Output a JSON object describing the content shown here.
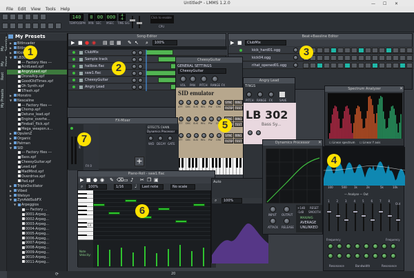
{
  "window": {
    "title": "Untitled* - LMMS 1.2.0"
  },
  "menu": [
    "File",
    "Edit",
    "View",
    "Tools",
    "Help"
  ],
  "toolbar": {
    "tempo": "140",
    "tempo_label": "TEMPO/BPM",
    "time_min": "0",
    "time_sec": "00",
    "time_msec": "000",
    "time_labels": [
      "MIN",
      "SEC",
      "MSEC"
    ],
    "timesig_top": "4",
    "timesig_bottom": "4",
    "timesig_label": "TIME SIG",
    "cpu_hint": "Click to enable",
    "cpu_label": "CPU"
  },
  "side_tabs": [
    "My Presets",
    "My Samples",
    "My Home",
    "Root"
  ],
  "presets": {
    "title": "My Presets",
    "rows": [
      {
        "label": "BitInvader",
        "indent": 2,
        "type": "folder",
        "open": false
      },
      {
        "label": "BitInvader",
        "indent": 2,
        "type": "folder",
        "open": false
      },
      {
        "label": "Kicker",
        "indent": 2,
        "type": "folder",
        "open": false
      },
      {
        "label": "LB302",
        "indent": 2,
        "type": "folder",
        "open": true
      },
      {
        "label": "--- Factory files ---",
        "indent": 4,
        "type": "file"
      },
      {
        "label": "AcidLead.xpf",
        "indent": 4,
        "type": "file"
      },
      {
        "label": "AngryLead.xpf",
        "indent": 4,
        "type": "file",
        "selected": true
      },
      {
        "label": "DroneArp.xpf",
        "indent": 4,
        "type": "file"
      },
      {
        "label": "GoodOldTimes.xpf",
        "indent": 4,
        "type": "file"
      },
      {
        "label": "Oh Synth.xpf",
        "indent": 4,
        "type": "file"
      },
      {
        "label": "STrash.xpf",
        "indent": 4,
        "type": "file"
      },
      {
        "label": "Monstro",
        "indent": 2,
        "type": "folder",
        "open": false
      },
      {
        "label": "Nescaline",
        "indent": 2,
        "type": "folder",
        "open": true
      },
      {
        "label": "--- Factory files ---",
        "indent": 4,
        "type": "file"
      },
      {
        "label": "Chomp.xpf",
        "indent": 4,
        "type": "file"
      },
      {
        "label": "Detune_lead.xpf",
        "indent": 4,
        "type": "file"
      },
      {
        "label": "Engine_overhe...",
        "indent": 4,
        "type": "file"
      },
      {
        "label": "Fireball_flick.xpf",
        "indent": 4,
        "type": "file"
      },
      {
        "label": "Mega_weapon.x...",
        "indent": 4,
        "type": "file"
      },
      {
        "label": "OpulenZ",
        "indent": 2,
        "type": "folder",
        "open": false
      },
      {
        "label": "Organic",
        "indent": 2,
        "type": "folder",
        "open": false
      },
      {
        "label": "Patman",
        "indent": 2,
        "type": "folder",
        "open": false
      },
      {
        "label": "SID",
        "indent": 2,
        "type": "folder",
        "open": true
      },
      {
        "label": "--- Factory files ---",
        "indent": 4,
        "type": "file"
      },
      {
        "label": "Bass.xpf",
        "indent": 4,
        "type": "file"
      },
      {
        "label": "CheesyGuitar.xpf",
        "indent": 4,
        "type": "file"
      },
      {
        "label": "Lead.xpf",
        "indent": 4,
        "type": "file"
      },
      {
        "label": "MadMind.xpf",
        "indent": 4,
        "type": "file"
      },
      {
        "label": "Overdrive.xpf",
        "indent": 4,
        "type": "file"
      },
      {
        "label": "Pad.xpf",
        "indent": 4,
        "type": "file"
      },
      {
        "label": "TripleOscillator",
        "indent": 2,
        "type": "folder",
        "open": false
      },
      {
        "label": "Vibed",
        "indent": 2,
        "type": "folder",
        "open": false
      },
      {
        "label": "Watsyn",
        "indent": 2,
        "type": "folder",
        "open": false
      },
      {
        "label": "ZynAddSubFX",
        "indent": 2,
        "type": "folder",
        "open": true
      },
      {
        "label": "Arpeggios",
        "indent": 4,
        "type": "folder",
        "open": true
      },
      {
        "label": "--- Factory ...",
        "indent": 6,
        "type": "file"
      },
      {
        "label": "0001-Arpeg...",
        "indent": 6,
        "type": "file"
      },
      {
        "label": "0002-Arpeg...",
        "indent": 6,
        "type": "file"
      },
      {
        "label": "0003-Arpeg...",
        "indent": 6,
        "type": "file"
      },
      {
        "label": "0004-Arpeg...",
        "indent": 6,
        "type": "file"
      },
      {
        "label": "0005-Arpeg...",
        "indent": 6,
        "type": "file"
      },
      {
        "label": "0006-Arpeg...",
        "indent": 6,
        "type": "file"
      },
      {
        "label": "0007-Arpeg...",
        "indent": 6,
        "type": "file"
      },
      {
        "label": "0008-Arpeg...",
        "indent": 6,
        "type": "file"
      },
      {
        "label": "0009-Arpeg...",
        "indent": 6,
        "type": "file"
      },
      {
        "label": "0010-Arpeg...",
        "indent": 6,
        "type": "file"
      },
      {
        "label": "0011-Arpeg...",
        "indent": 6,
        "type": "file"
      }
    ]
  },
  "song_editor": {
    "title": "Song-Editor",
    "zoom": "100%",
    "tracks": [
      {
        "name": "ClubMix"
      },
      {
        "name": "Sample track"
      },
      {
        "name": "hallbse.flac"
      },
      {
        "name": "saw1.flac"
      },
      {
        "name": "CheesyGuitar"
      },
      {
        "name": "Angry Lead"
      }
    ]
  },
  "bb_editor": {
    "title": "Beat+Bassline Editor",
    "selected": "ClubMix",
    "tracks": [
      {
        "name": "kick_hard01.ogg"
      },
      {
        "name": "kick04.ogg"
      },
      {
        "name": "rihat_opened01.ogg"
      }
    ],
    "patterns": [
      [
        1,
        0,
        0,
        0,
        1,
        0,
        0,
        0,
        1,
        0,
        0,
        0,
        1,
        0,
        0,
        0
      ],
      [
        0,
        0,
        0,
        0,
        0,
        0,
        0,
        0,
        0,
        0,
        0,
        0,
        0,
        0,
        0,
        0
      ],
      [
        0,
        0,
        1,
        0,
        0,
        0,
        1,
        0,
        0,
        0,
        1,
        0,
        0,
        0,
        1,
        0
      ]
    ]
  },
  "instrument_cheesy": {
    "title": "CheesyGuitar",
    "general_settings": "GENERAL SETTINGS",
    "name_field": "CheesyGuitar",
    "knob_labels": [
      "VOL",
      "PAN",
      "PITCH",
      "RANGE",
      "FX"
    ],
    "plugin_title": "SID emulator",
    "sid_buttons": [
      "ATT",
      "DEC",
      "SUS",
      "REL",
      "PW",
      "CRS",
      "SYNC",
      "RING",
      "FILTERED",
      "TEST"
    ],
    "sid_right": [
      "ATT",
      "DEC",
      "SUS",
      "REL",
      "PW",
      "CRS"
    ]
  },
  "instrument_angry": {
    "title": "Angry Lead",
    "tab": "TINGS",
    "knob_labels": [
      "PITCH",
      "RANGE",
      "FX",
      "SAVE"
    ],
    "plugin_title": "LB 302",
    "plugin_sub": "Bass Sy..."
  },
  "fx_mixer": {
    "title": "FX-Mixer",
    "chain_title": "EFFECTS CHAIN",
    "effect_name": "Dynamics Processor",
    "knob_labels": [
      "W/D",
      "DECAY",
      "GATE"
    ],
    "channel_label": "FX 0",
    "master_label": "Master",
    "add_button": "+"
  },
  "piano_roll": {
    "title": "Piano-Roll - saw1.flac",
    "zoom": "100%",
    "quant": "1/16",
    "note_len": "Last note",
    "scale": "No scale",
    "note_velocity_label": "Note Velocity:",
    "key_label": "C4",
    "notes": [
      {
        "row": 3,
        "start": 0.0,
        "len": 0.1
      },
      {
        "row": 5,
        "start": 0.13,
        "len": 0.1
      },
      {
        "row": 2,
        "start": 0.27,
        "len": 0.1
      },
      {
        "row": 6,
        "start": 0.4,
        "len": 0.1
      },
      {
        "row": 4,
        "start": 0.55,
        "len": 0.1
      },
      {
        "row": 7,
        "start": 0.7,
        "len": 0.1
      },
      {
        "row": 3,
        "start": 0.85,
        "len": 0.1
      }
    ],
    "velocities": [
      0.9,
      0.7,
      0.8,
      0.6,
      0.85,
      0.55,
      0.75,
      0.9,
      0.65,
      0.8
    ]
  },
  "automation": {
    "label": "Auto",
    "zoom": "100%",
    "bottom_value": "20"
  },
  "dynamics": {
    "title": "Dynamics Processor",
    "knob_labels": [
      "INPUT",
      "OUTPUT",
      "ATTACK",
      "RELEASE"
    ],
    "right_buttons": [
      "+1dB",
      "RESET",
      "-1dB",
      "SMOOTH"
    ],
    "mode_labels": [
      "MAX/AVG",
      "AVERAGE",
      "UNLINKED"
    ]
  },
  "spectrum": {
    "title": "Spectrum Analyzer",
    "option_linear_spectrum": "Linear spectrum",
    "option_linear_y": "Linear Y axis",
    "freq_labels": [
      "100",
      "500",
      "1k",
      "2k",
      "5k",
      "10k"
    ],
    "legend_analyse": "Analyse",
    "legend_out": "Out"
  },
  "eq": {
    "out_label": "Out",
    "freq_labels": [
      "Frequency",
      "Frequency"
    ],
    "group_labels": [
      "Resonance",
      "Bandwidth",
      "Resonance"
    ],
    "band_labels": [
      "1",
      "2",
      "3",
      "4",
      "5",
      "6",
      "7",
      "8"
    ]
  },
  "badges": [
    "1",
    "2",
    "3",
    "4",
    "5",
    "6",
    "7"
  ],
  "colors": {
    "accent_green": "#3fbf3f",
    "badge_yellow": "#ffe200",
    "bb_cyan": "#1fb7a7"
  }
}
